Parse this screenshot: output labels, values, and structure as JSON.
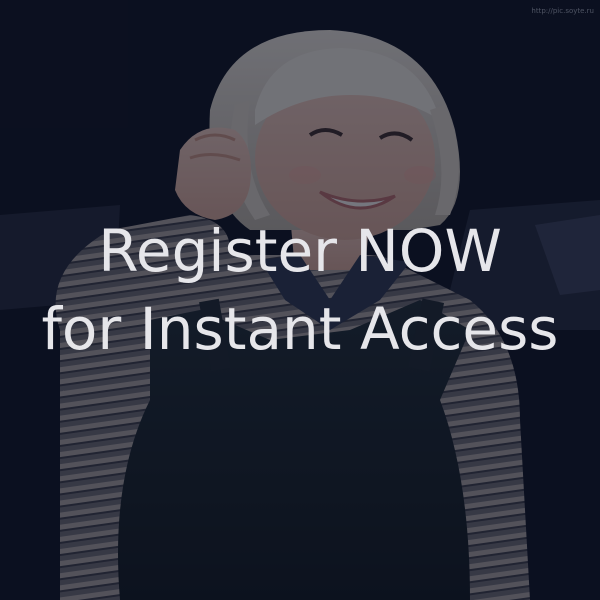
{
  "cta": {
    "line1": "Register NOW",
    "line2": "for Instant Access"
  },
  "watermark": "http://pic.soyte.ru",
  "colors": {
    "background": "#0a0f1e",
    "overlay": "#0c1020",
    "text": "#e6e6ea"
  },
  "photo": {
    "subject": "smiling-woman-photo"
  }
}
